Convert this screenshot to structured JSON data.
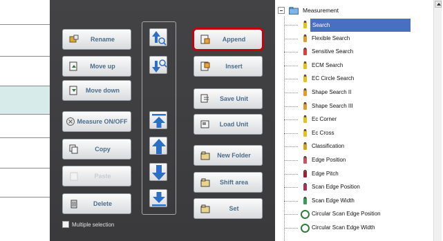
{
  "controls": {
    "buttons": {
      "rename": "Rename",
      "move_up": "Move up",
      "move_down": "Move down",
      "measure_onoff": "Measure ON/OFF",
      "copy": "Copy",
      "paste": "Paste",
      "delete": "Delete",
      "append": "Append",
      "insert": "Insert",
      "save_unit": "Save Unit",
      "load_unit": "Load Unit",
      "new_folder": "New Folder",
      "shift_area": "Shift area",
      "set": "Set"
    },
    "multiple_selection": "Multiple selection",
    "accent_color": "#c8000e"
  },
  "tree": {
    "root": "Measurement",
    "items": [
      {
        "label": "Search",
        "selected": true,
        "icon": "search-icon"
      },
      {
        "label": "Flexible Search",
        "icon": "flexible-search-icon"
      },
      {
        "label": "Sensitive Search",
        "icon": "sensitive-search-icon"
      },
      {
        "label": "ECM Search",
        "icon": "ecm-search-icon"
      },
      {
        "label": "EC Circle Search",
        "icon": "ec-circle-search-icon"
      },
      {
        "label": "Shape Search II",
        "icon": "shape-search-icon"
      },
      {
        "label": "Shape Search III",
        "icon": "shape-search-icon"
      },
      {
        "label": "Ec Corner",
        "icon": "ec-corner-icon"
      },
      {
        "label": "Ec Cross",
        "icon": "ec-cross-icon"
      },
      {
        "label": "Classification",
        "icon": "classification-icon"
      },
      {
        "label": "Edge Position",
        "icon": "edge-position-icon"
      },
      {
        "label": "Edge Pitch",
        "icon": "edge-pitch-icon"
      },
      {
        "label": "Scan Edge Position",
        "icon": "scan-edge-position-icon"
      },
      {
        "label": "Scan Edge Width",
        "icon": "scan-edge-width-icon"
      },
      {
        "label": "Circular Scan Edge Position",
        "icon": "circular-scan-edge-position-icon"
      },
      {
        "label": "Circular Scan Edge Width",
        "icon": "circular-scan-edge-width-icon"
      }
    ],
    "selection_color": "#4a6fc2"
  }
}
